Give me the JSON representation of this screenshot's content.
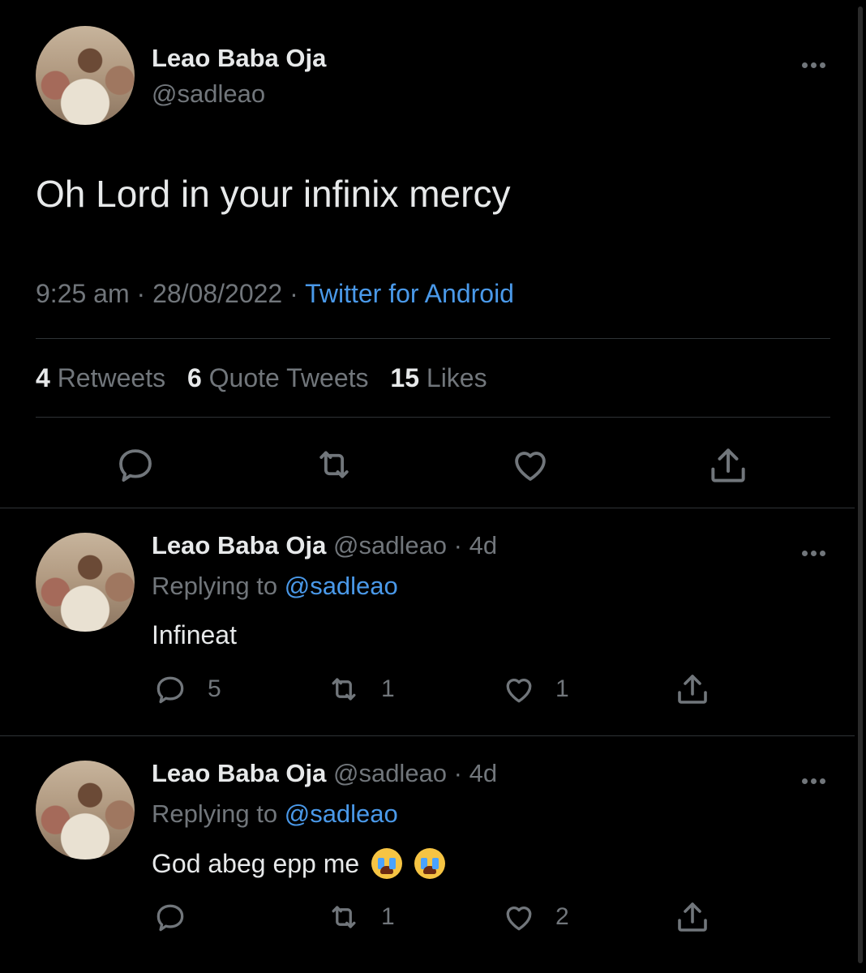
{
  "main_tweet": {
    "author_name": "Leao Baba Oja",
    "author_handle": "@sadleao",
    "text": "Oh Lord in your infinix mercy",
    "time": "9:25 am",
    "date": "28/08/2022",
    "separator": "·",
    "source": "Twitter for Android",
    "stats": {
      "retweets_count": "4",
      "retweets_label": "Retweets",
      "quotes_count": "6",
      "quotes_label": "Quote Tweets",
      "likes_count": "15",
      "likes_label": "Likes"
    },
    "icons": [
      "reply-icon",
      "retweet-icon",
      "like-icon",
      "share-icon"
    ]
  },
  "replies": [
    {
      "author_name": "Leao Baba Oja",
      "author_handle": "@sadleao",
      "age": "· 4d",
      "replying_prefix": "Replying to",
      "replying_to": "@sadleao",
      "text": "Infineat",
      "reply_count": "5",
      "retweet_count": "1",
      "like_count": "1"
    },
    {
      "author_name": "Leao Baba Oja",
      "author_handle": "@sadleao",
      "age": "· 4d",
      "replying_prefix": "Replying to",
      "replying_to": "@sadleao",
      "text": "God abeg epp me",
      "emojis": [
        "loudly-crying-face",
        "loudly-crying-face"
      ],
      "reply_count": "",
      "retweet_count": "1",
      "like_count": "2"
    }
  ],
  "colors": {
    "background": "#000000",
    "text_primary": "#e7e9ea",
    "text_secondary": "#71767b",
    "accent": "#4a99e9",
    "divider": "#2f3336"
  }
}
